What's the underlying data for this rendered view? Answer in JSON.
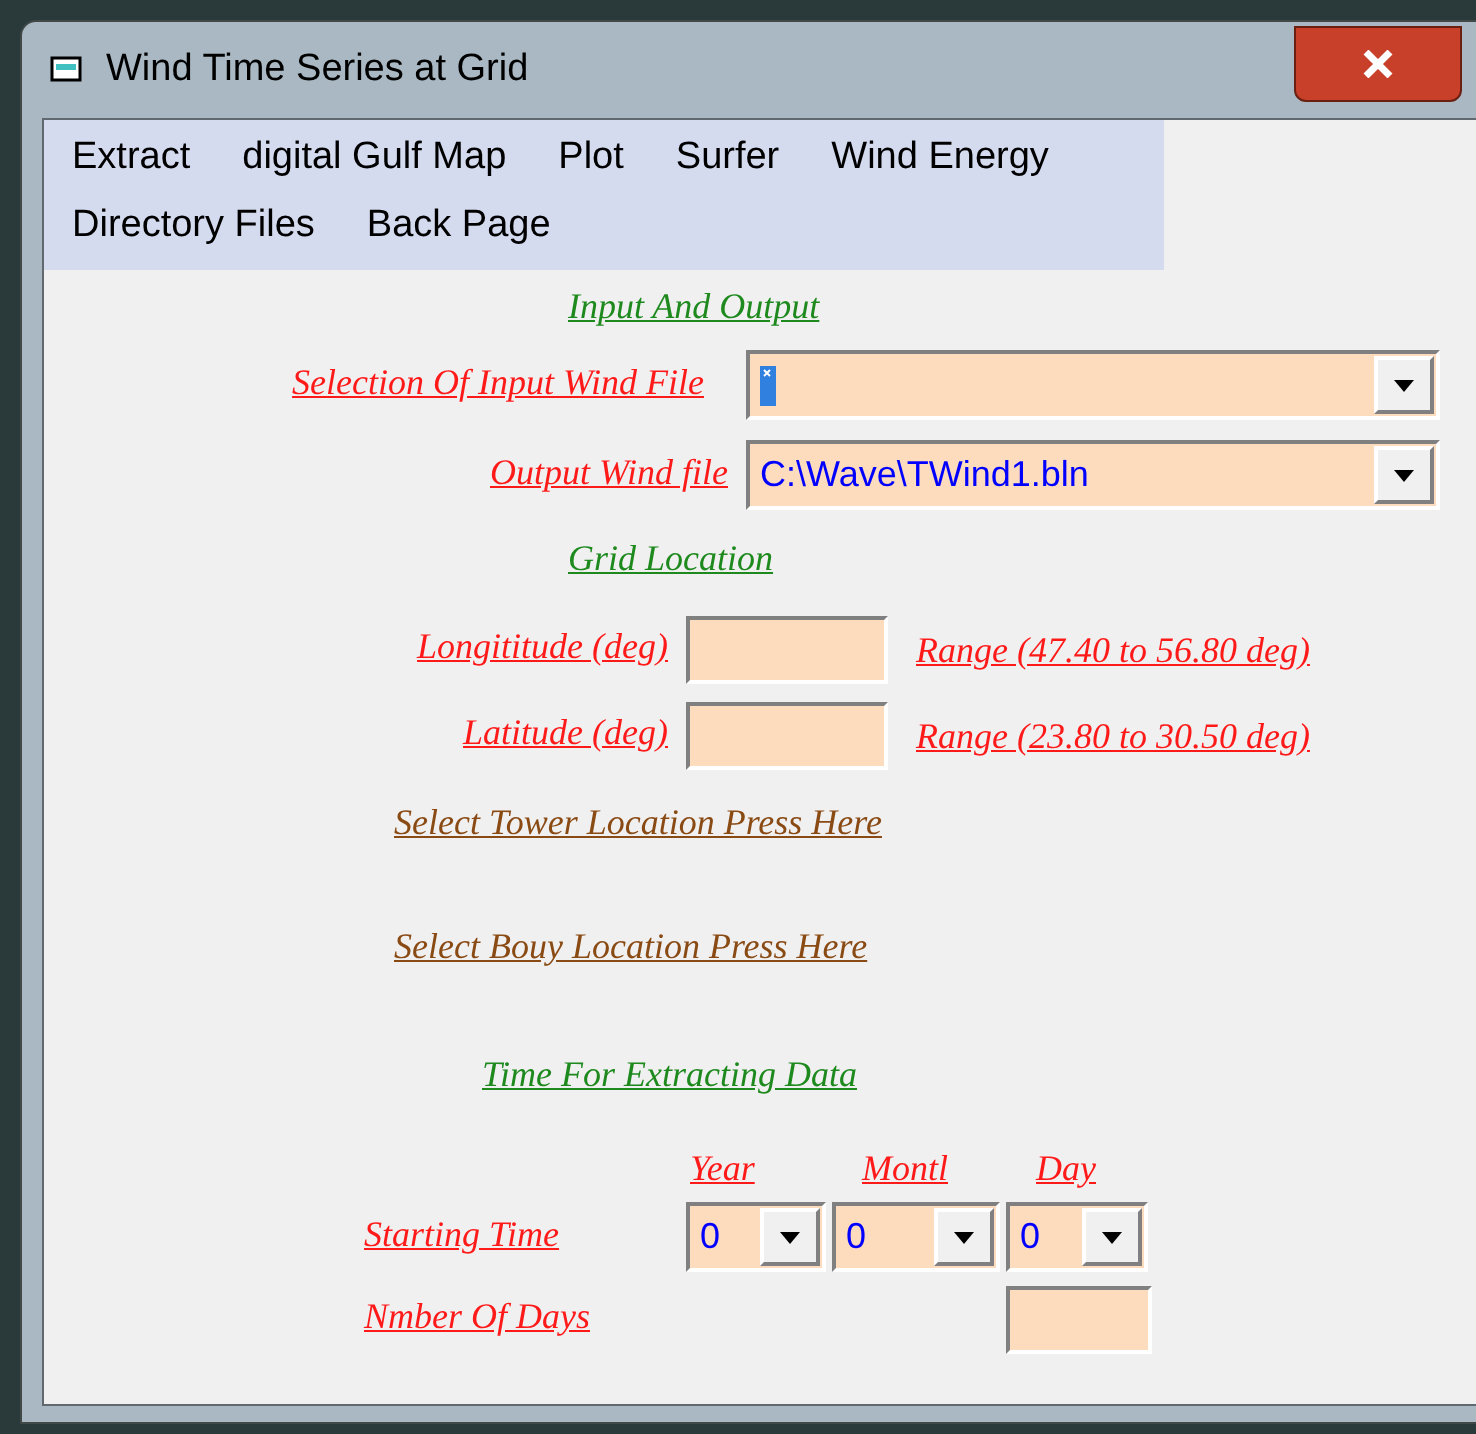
{
  "window": {
    "title": "Wind Time Series at Grid"
  },
  "menu": [
    {
      "label": "Extract"
    },
    {
      "label": "digital Gulf Map"
    },
    {
      "label": "Plot"
    },
    {
      "label": "Surfer"
    },
    {
      "label": "Wind Energy"
    },
    {
      "label": "Directory Files"
    },
    {
      "label": "Back Page"
    }
  ],
  "input_output": {
    "heading": "Input And Output",
    "input_file_label": "Selection Of Input Wind File",
    "output_file_label": "Output Wind file",
    "output_file_value": "C:\\Wave\\TWind1.bln"
  },
  "grid_location": {
    "heading": "Grid Location",
    "longitude_label": "Longititude (deg)",
    "longitude_range": "Range (47.40 to 56.80 deg)",
    "latitude_label": "Latitude (deg)",
    "latitude_range": "Range (23.80 to 30.50 deg)"
  },
  "links": [
    "Select Tower Location Press Here",
    "Select Bouy Location Press Here"
  ],
  "time": {
    "heading": "Time For Extracting Data",
    "starting_label": "Starting Time",
    "days_label": "Nmber Of Days",
    "fields": [
      {
        "header": "Year",
        "value": "0"
      },
      {
        "header": "Montl",
        "value": "0"
      },
      {
        "header": "Day",
        "value": "0"
      }
    ]
  }
}
